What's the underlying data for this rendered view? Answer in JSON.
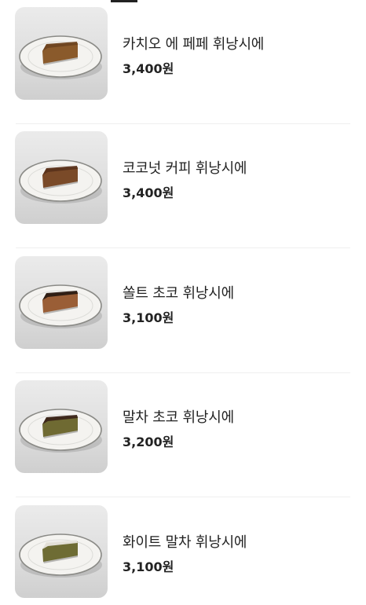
{
  "menu": {
    "items": [
      {
        "name": "카치오 에 페페 휘낭시에",
        "price": "3,400원",
        "image_icon": "financier-photo-cacio-e-pepe",
        "cake_color": "#8a5a2b",
        "top_color": "#6e4420"
      },
      {
        "name": "코코넛 커피 휘낭시에",
        "price": "3,400원",
        "image_icon": "financier-photo-coconut-coffee",
        "cake_color": "#7a4a28",
        "top_color": "#5a321a"
      },
      {
        "name": "쏠트 초코 휘낭시에",
        "price": "3,100원",
        "image_icon": "financier-photo-salt-choco",
        "cake_color": "#9a5e36",
        "top_color": "#2a1a12"
      },
      {
        "name": "말차 초코 휘낭시에",
        "price": "3,200원",
        "image_icon": "financier-photo-matcha-choco",
        "cake_color": "#6f6a32",
        "top_color": "#3a2418"
      },
      {
        "name": "화이트 말차 휘낭시에",
        "price": "3,100원",
        "image_icon": "financier-photo-white-matcha",
        "cake_color": "#6e6c34",
        "top_color": "#e8e6e0"
      }
    ]
  }
}
